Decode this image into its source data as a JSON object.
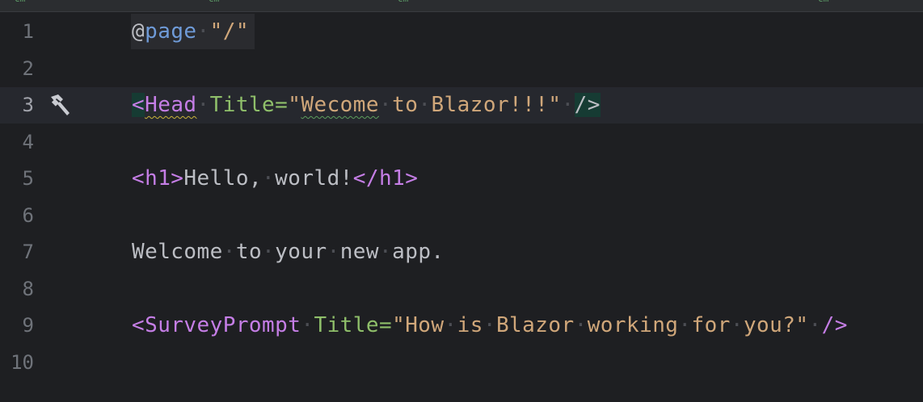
{
  "tabs": {
    "marks": [
      "cm",
      "cm",
      "cm",
      "cm"
    ]
  },
  "lines": [
    {
      "num": "1"
    },
    {
      "num": "2"
    },
    {
      "num": "3"
    },
    {
      "num": "4"
    },
    {
      "num": "5"
    },
    {
      "num": "6"
    },
    {
      "num": "7"
    },
    {
      "num": "8"
    },
    {
      "num": "9"
    },
    {
      "num": "10"
    }
  ],
  "code": {
    "l1": {
      "at": "@",
      "kw": "page",
      "str": "\"/\""
    },
    "l3": {
      "lt": "<",
      "tag": "Head",
      "attr": "Title=",
      "q1": "\"",
      "s1": "Wecome",
      "s2": "to",
      "s3": "Blazor!!!\"",
      "close": "/>"
    },
    "l5": {
      "open": "<h1>",
      "text1": "Hello,",
      "text2": "world!",
      "close": "</h1>"
    },
    "l7": {
      "w1": "Welcome",
      "w2": "to",
      "w3": "your",
      "w4": "new",
      "w5": "app."
    },
    "l9": {
      "lt": "<",
      "tag": "SurveyPrompt",
      "attr": "Title=",
      "s1": "\"How",
      "s2": "is",
      "s3": "Blazor",
      "s4": "working",
      "s5": "for",
      "s6": "you?\"",
      "close": "/>"
    }
  },
  "icons": {
    "line3_gutter": "hammer-icon"
  },
  "colors": {
    "background": "#1e1f22",
    "keyword": "#6f9bd8",
    "string": "#d0a77a",
    "tag": "#c57ee6",
    "attribute": "#8fbf6a",
    "text": "#bcbec4",
    "line_number": "#6f737a"
  }
}
